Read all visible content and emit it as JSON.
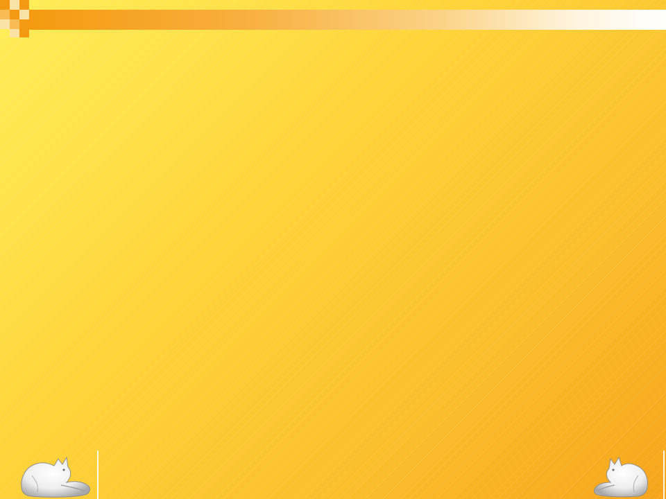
{
  "colors": {
    "background_start": "#ffee5a",
    "background_end": "#f7a51c",
    "accent": "#f49a12",
    "accent_light": "#fbe2a6",
    "divider": "#ffffff"
  },
  "decorations": {
    "left_cat": "cat-figure-icon",
    "right_cat": "cat-figure-icon",
    "corner_squares": "checker-squares-icon"
  }
}
